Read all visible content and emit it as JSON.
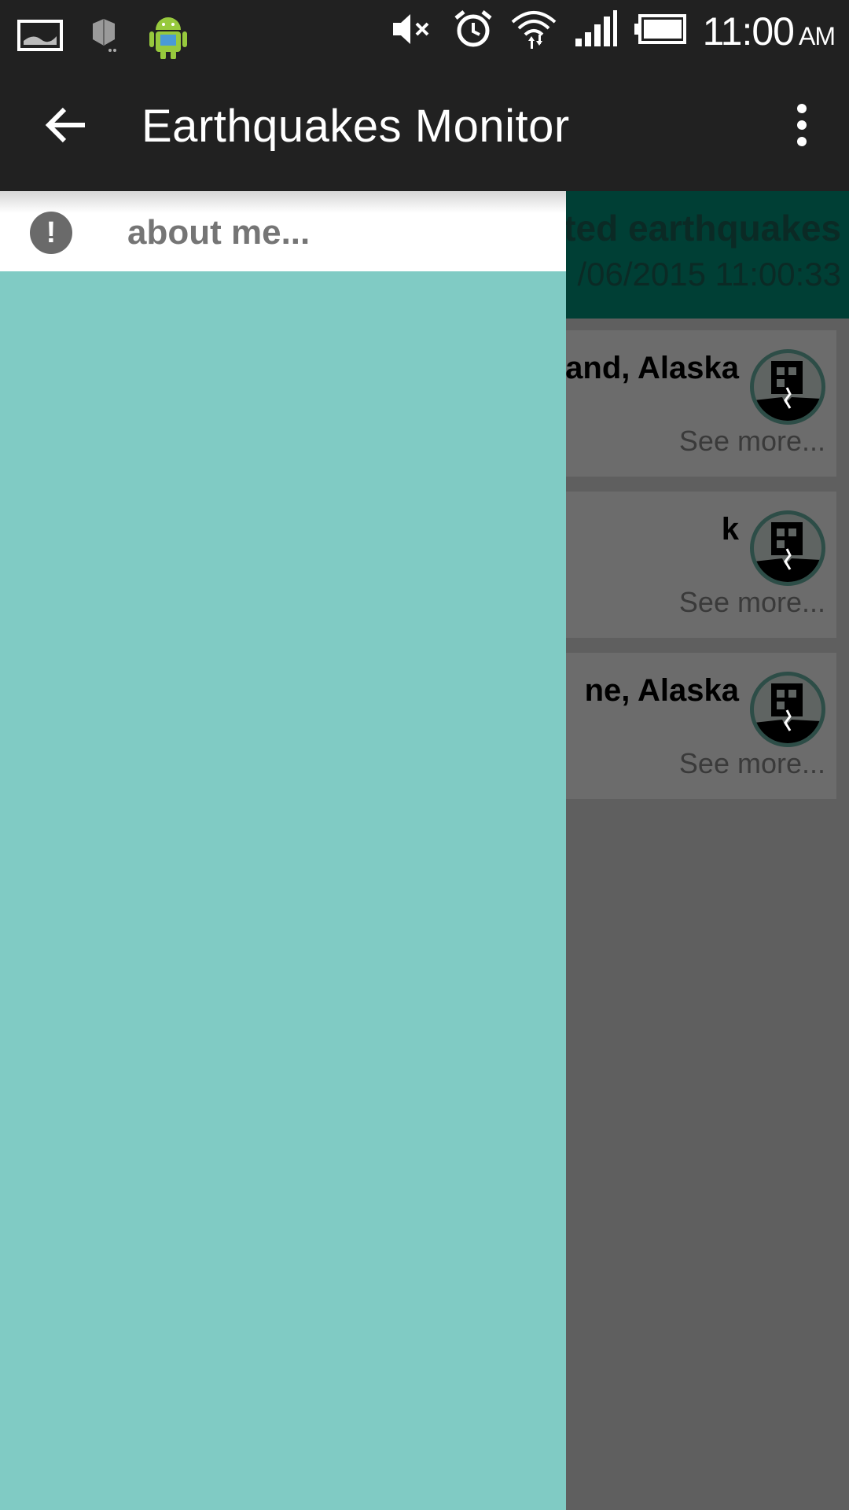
{
  "status_bar": {
    "time": "11:00",
    "ampm": "AM",
    "icons": [
      "picture-icon",
      "dropbox-icon",
      "android-icon",
      "mute-icon",
      "alarm-icon",
      "wifi-icon",
      "signal-icon",
      "battery-icon"
    ]
  },
  "app_bar": {
    "title": "Earthquakes Monitor",
    "back_icon": "arrow-back-icon",
    "menu_icon": "overflow-menu-icon"
  },
  "drawer": {
    "items": [
      {
        "label": "about me...",
        "icon": "alert-icon",
        "icon_glyph": "!"
      }
    ],
    "background": "#80cbc4"
  },
  "content": {
    "header_title": "ted earthquakes",
    "header_date": "/06/2015 11:00:33",
    "cards": [
      {
        "title": "and, Alaska",
        "more": "See more..."
      },
      {
        "title": "k",
        "more": "See more..."
      },
      {
        "title": "ne, Alaska",
        "more": "See more..."
      }
    ]
  },
  "colors": {
    "bar": "#212121",
    "accent_header": "#004d40",
    "drawer": "#80cbc4",
    "scrim": "#5f5f5f"
  }
}
